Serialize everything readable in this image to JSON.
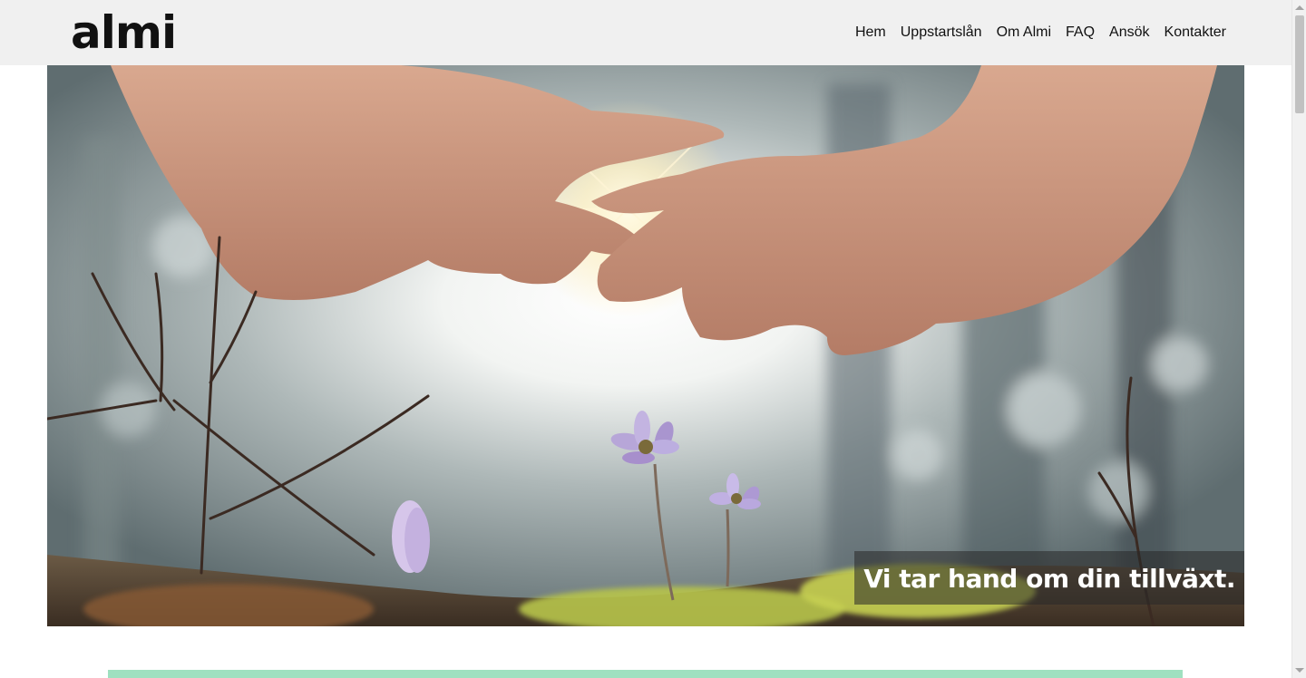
{
  "header": {
    "logo": "almi",
    "nav": [
      "Hem",
      "Uppstartslån",
      "Om Almi",
      "FAQ",
      "Ansök",
      "Kontakter"
    ]
  },
  "hero": {
    "tagline": "Vi tar hand om din tillväxt."
  },
  "colors": {
    "header_bg": "#f0f0f0",
    "accent_band": "#9fe0c0",
    "tagline_bg": "rgba(40,40,40,0.55)"
  }
}
